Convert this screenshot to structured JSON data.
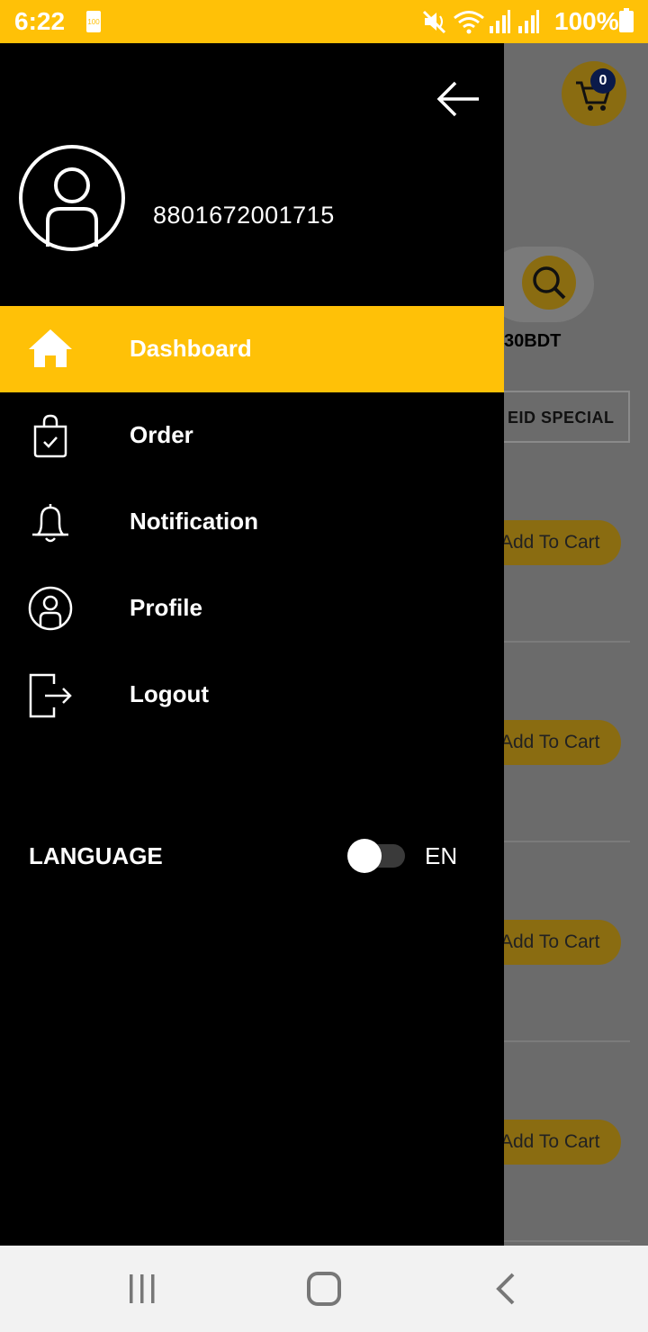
{
  "status_bar": {
    "time": "6:22",
    "battery_small_text": "100",
    "battery_percent": "100%",
    "icons": [
      "mute-icon",
      "wifi-icon",
      "signal-icon",
      "signal-icon",
      "battery-icon"
    ]
  },
  "background": {
    "cart_count": "0",
    "price_fragment": "30BDT",
    "category_chip": "EID SPECIAL",
    "add_to_cart_labels": [
      "Add To Cart",
      "Add To Cart",
      "Add To Cart",
      "Add To Cart"
    ]
  },
  "drawer": {
    "phone": "8801672001715",
    "menu": [
      {
        "label": "Dashboard",
        "icon": "home-icon",
        "active": true
      },
      {
        "label": "Order",
        "icon": "shopping-bag-icon",
        "active": false
      },
      {
        "label": "Notification",
        "icon": "bell-icon",
        "active": false
      },
      {
        "label": "Profile",
        "icon": "profile-icon",
        "active": false
      },
      {
        "label": "Logout",
        "icon": "logout-icon",
        "active": false
      }
    ],
    "language_label": "LANGUAGE",
    "language_value": "EN"
  },
  "colors": {
    "accent": "#FFC107",
    "drawer_bg": "#000000",
    "navbar_bg": "#F2F2F2"
  }
}
